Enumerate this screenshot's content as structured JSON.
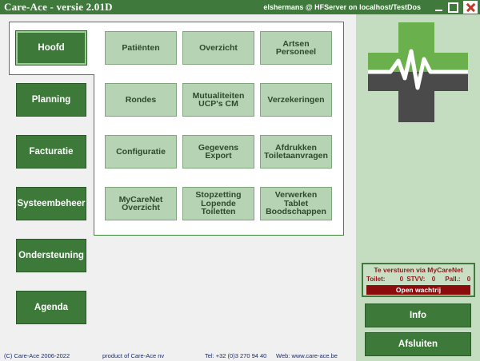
{
  "window": {
    "title": "Care-Ace - versie 2.01D",
    "user_info": "elshermans @ HFServer on localhost/TestDos"
  },
  "sidebar": {
    "items": [
      {
        "label": "Hoofd",
        "active": true
      },
      {
        "label": "Planning",
        "active": false
      },
      {
        "label": "Facturatie",
        "active": false
      },
      {
        "label": "Systeembeheer",
        "active": false
      },
      {
        "label": "Ondersteuning",
        "active": false
      },
      {
        "label": "Agenda",
        "active": false
      }
    ]
  },
  "grid": {
    "buttons": [
      {
        "label": "Patiënten"
      },
      {
        "label": "Overzicht"
      },
      {
        "label": "Artsen\nPersoneel"
      },
      {
        "label": "Rondes"
      },
      {
        "label": "Mutualiteiten\nUCP's CM"
      },
      {
        "label": "Verzekeringen"
      },
      {
        "label": "Configuratie"
      },
      {
        "label": "Gegevens\nExport"
      },
      {
        "label": "Afdrukken\nToiletaanvragen"
      },
      {
        "label": "MyCareNet\nOverzicht"
      },
      {
        "label": "Stopzetting\nLopende\nToiletten"
      },
      {
        "label": "Verwerken\nTablet\nBoodschappen"
      }
    ]
  },
  "mycarenet": {
    "title": "Te versturen via MyCareNet",
    "toilet_label": "Toilet:",
    "toilet_count": "0",
    "stvv_label": "STVV:",
    "stvv_count": "0",
    "pall_label": "Pall.:",
    "pall_count": "0",
    "queue_button": "Open wachtrij"
  },
  "actions": {
    "info": "Info",
    "close": "Afsluiten"
  },
  "footer": {
    "copyright": "(C) Care-Ace 2006-2022",
    "product": "product of Care-Ace nv",
    "phone": "Tel: +32 (0)3 270 94 40",
    "web": "Web: www.care-ace.be"
  },
  "colors": {
    "titlebar": "#3f7a3c",
    "primary_button": "#3d7a3a",
    "grid_button": "#b6d3b3",
    "right_panel": "#c4ddc0",
    "logo_light": "#6ab04c",
    "logo_dark": "#4a4a4a",
    "alert": "#8a0c0c"
  },
  "icons": {
    "logo": "care-cross-heartbeat-icon"
  }
}
